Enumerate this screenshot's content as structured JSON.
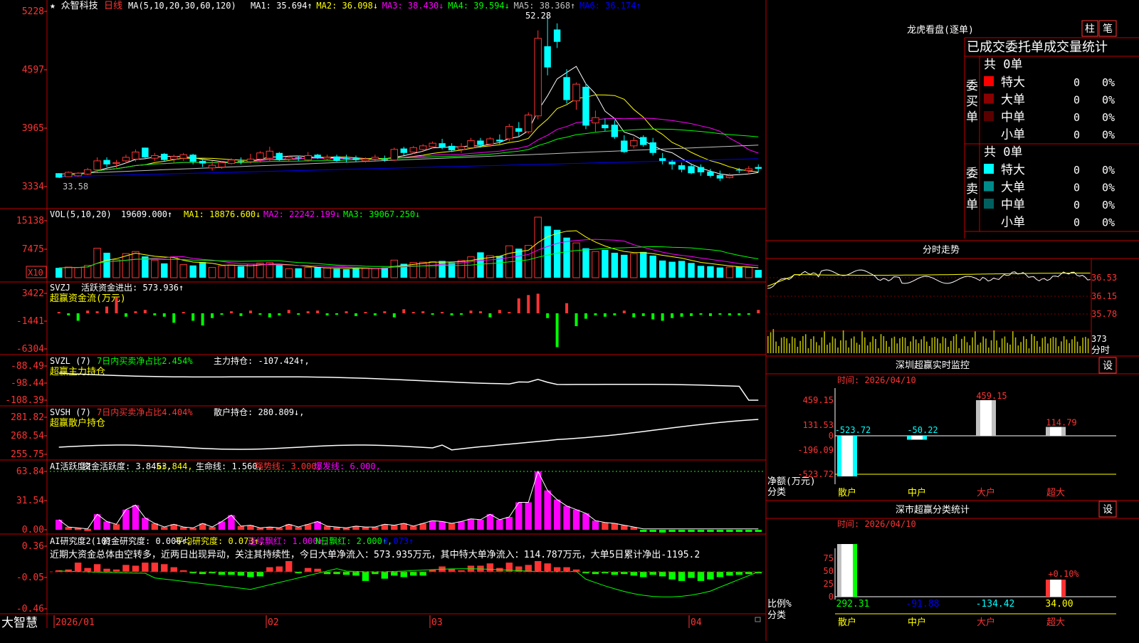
{
  "chart_data": [
    {
      "type": "candlestick",
      "stock_name": "众智科技",
      "period": "日线",
      "ma_params": "MA(5,10,20,30,60,120)",
      "ma_values": [
        {
          "name": "MA1",
          "value": "35.694",
          "arrow": "↑",
          "color": "#ffffff"
        },
        {
          "name": "MA2",
          "value": "36.098",
          "arrow": "↓",
          "color": "#ffff00"
        },
        {
          "name": "MA3",
          "value": "38.430",
          "arrow": "↓",
          "color": "#ff00ff"
        },
        {
          "name": "MA4",
          "value": "39.594",
          "arrow": "↓",
          "color": "#00ff00"
        },
        {
          "name": "MA5",
          "value": "38.368",
          "arrow": "↑",
          "color": "#c0c0c0"
        },
        {
          "name": "MA6",
          "value": "36.174",
          "arrow": "↑",
          "color": "#0000ff"
        }
      ],
      "y_ticks": [
        "5228",
        "4597",
        "3965",
        "3334"
      ],
      "y_range": [
        32.5,
        53.5
      ],
      "annot_high": "52.28",
      "annot_low": "33.58",
      "ohlc": [
        [
          34.5,
          34.5,
          34.1,
          34.0
        ],
        [
          34.1,
          34.7,
          34.1,
          34.6
        ],
        [
          34.2,
          34.6,
          34.1,
          34.5
        ],
        [
          34.4,
          35.1,
          34.3,
          34.9
        ],
        [
          34.9,
          36.3,
          34.6,
          35.9
        ],
        [
          36.0,
          36.3,
          35.2,
          35.5
        ],
        [
          35.6,
          36.0,
          35.1,
          35.7
        ],
        [
          35.9,
          36.6,
          35.6,
          36.3
        ],
        [
          36.1,
          37.2,
          35.8,
          36.9
        ],
        [
          37.4,
          37.4,
          36.2,
          36.3
        ],
        [
          36.2,
          36.8,
          35.9,
          36.5
        ],
        [
          36.7,
          36.8,
          35.9,
          36.0
        ],
        [
          36.1,
          36.6,
          35.7,
          36.4
        ],
        [
          36.2,
          36.8,
          35.9,
          36.6
        ],
        [
          36.6,
          36.7,
          35.5,
          35.8
        ],
        [
          35.9,
          36.1,
          35.2,
          35.6
        ],
        [
          35.1,
          35.9,
          34.8,
          35.4
        ],
        [
          35.2,
          35.9,
          35.0,
          35.7
        ],
        [
          35.6,
          36.2,
          35.5,
          36.0
        ],
        [
          35.9,
          36.3,
          35.5,
          35.8
        ],
        [
          35.8,
          36.7,
          35.6,
          36.1
        ],
        [
          36.1,
          37.0,
          35.7,
          36.8
        ],
        [
          36.2,
          37.5,
          35.9,
          37.0
        ],
        [
          36.8,
          36.9,
          35.9,
          36.0
        ],
        [
          36.1,
          36.5,
          35.9,
          36.3
        ],
        [
          36.3,
          36.5,
          35.9,
          36.2
        ],
        [
          36.0,
          36.9,
          35.8,
          36.5
        ],
        [
          36.6,
          36.7,
          36.1,
          36.2
        ],
        [
          36.1,
          36.6,
          35.9,
          36.3
        ],
        [
          36.4,
          36.6,
          35.8,
          35.9
        ],
        [
          36.2,
          36.6,
          35.7,
          36.1
        ],
        [
          36.2,
          36.5,
          35.8,
          36.0
        ],
        [
          35.9,
          36.3,
          35.7,
          36.1
        ],
        [
          36.1,
          36.6,
          35.9,
          36.3
        ],
        [
          36.1,
          36.5,
          35.8,
          36.0
        ],
        [
          36.0,
          37.4,
          35.9,
          37.2
        ],
        [
          37.3,
          37.5,
          36.5,
          36.8
        ],
        [
          36.9,
          37.6,
          36.7,
          37.4
        ],
        [
          37.2,
          37.8,
          37.0,
          37.6
        ],
        [
          37.5,
          38.1,
          37.3,
          37.9
        ],
        [
          37.9,
          38.4,
          37.2,
          37.4
        ],
        [
          37.6,
          37.9,
          36.9,
          37.1
        ],
        [
          37.2,
          37.9,
          36.8,
          37.5
        ],
        [
          37.4,
          38.5,
          37.3,
          38.2
        ],
        [
          38.2,
          38.5,
          37.4,
          37.7
        ],
        [
          37.8,
          38.6,
          37.5,
          38.4
        ],
        [
          38.3,
          38.9,
          37.8,
          38.1
        ],
        [
          38.4,
          40.1,
          38.1,
          39.8
        ],
        [
          39.6,
          40.3,
          38.7,
          39.2
        ],
        [
          39.2,
          41.4,
          39.0,
          41.1
        ],
        [
          41.0,
          50.7,
          40.6,
          49.8
        ],
        [
          48.9,
          52.3,
          45.6,
          46.5
        ],
        [
          50.8,
          51.5,
          48.7,
          49.4
        ],
        [
          45.4,
          46.3,
          42.4,
          42.8
        ],
        [
          42.7,
          44.8,
          41.7,
          44.6
        ],
        [
          44.3,
          44.7,
          39.5,
          39.9
        ],
        [
          40.2,
          41.6,
          39.1,
          40.8
        ],
        [
          40.0,
          40.7,
          39.3,
          39.6
        ],
        [
          40.0,
          40.5,
          38.4,
          38.6
        ],
        [
          38.2,
          38.8,
          36.8,
          36.9
        ],
        [
          37.6,
          38.6,
          37.3,
          38.2
        ],
        [
          38.6,
          38.8,
          37.5,
          37.7
        ],
        [
          38.0,
          38.5,
          36.5,
          36.8
        ],
        [
          36.2,
          36.8,
          35.5,
          35.9
        ],
        [
          35.8,
          36.0,
          34.9,
          35.5
        ],
        [
          35.4,
          35.7,
          34.6,
          34.9
        ],
        [
          35.3,
          35.6,
          34.4,
          34.5
        ],
        [
          35.2,
          35.5,
          34.2,
          34.6
        ],
        [
          34.7,
          35.0,
          34.0,
          34.2
        ],
        [
          34.3,
          34.8,
          33.6,
          33.9
        ],
        [
          34.0,
          34.5,
          33.9,
          34.2
        ],
        [
          34.9,
          35.1,
          34.5,
          34.8
        ],
        [
          34.8,
          35.3,
          34.4,
          35.0
        ],
        [
          35.2,
          35.5,
          34.6,
          35.0
        ]
      ],
      "volume": {
        "params": "VOL(5,10,20)",
        "value": "19609.000",
        "ma_values": [
          {
            "name": "MA1",
            "value": "18876.600",
            "arrow": "↓",
            "color": "#ffff00"
          },
          {
            "name": "MA2",
            "value": "22242.199",
            "arrow": "↓",
            "color": "#ff00ff"
          },
          {
            "name": "MA3",
            "value": "39067.250",
            "arrow": "↓",
            "color": "#00ff00"
          }
        ],
        "y_ticks": [
          "15138",
          "7475",
          "X10"
        ],
        "unit_tag": "X10",
        "values": [
          2400,
          2600,
          2500,
          3000,
          7200,
          6100,
          4400,
          5900,
          6400,
          5200,
          4300,
          3500,
          5100,
          3200,
          3000,
          3800,
          2500,
          2900,
          3100,
          2800,
          3300,
          3600,
          3700,
          3100,
          2200,
          2300,
          2500,
          2600,
          2400,
          2200,
          2100,
          2300,
          2400,
          2300,
          2500,
          4300,
          3400,
          3700,
          3800,
          3900,
          4100,
          3700,
          4200,
          5100,
          6200,
          5400,
          5300,
          7800,
          7100,
          7900,
          14800,
          12600,
          11700,
          9800,
          8500,
          7200,
          6400,
          6800,
          6100,
          5600,
          5900,
          6300,
          5400,
          4200,
          3900,
          4100,
          3600,
          2900,
          2800,
          2500,
          2600,
          2700,
          2500,
          1900
        ]
      }
    }
  ],
  "indicators": {
    "svzj": {
      "name": "SVZJ",
      "title": "活跃资金进出",
      "value": "573.936",
      "arrow": "↑",
      "subtitle": "超赢资金流(万元)",
      "y_ticks": [
        "3422",
        "-1441",
        "-6304"
      ]
    },
    "svzl": {
      "name": "SVZL (7)",
      "pct_label": "7日内买卖净占比",
      "pct_value": "2.454%",
      "title": "主力持仓",
      "value": "-107.424",
      "arrow": "↑",
      "subtitle": "超赢主力持仓",
      "y_ticks": [
        "-88.49",
        "-98.44",
        "-108.39"
      ]
    },
    "svsh": {
      "name": "SVSH (7)",
      "pct_label": "7日内买卖净占比",
      "pct_value": "4.404%",
      "title": "散户持仓",
      "value": "280.809",
      "arrow": "↓",
      "subtitle": "超赢散户持仓",
      "y_ticks": [
        "281.82",
        "268.54",
        "255.75"
      ]
    },
    "ai_active": {
      "name": "AI活跃度2",
      "title": "资金活跃度",
      "value": "3.845",
      "arrow": "↑",
      "val2": "63.844",
      "life_label": "生命线",
      "life_value": "1.560",
      "strong_label": "强势线",
      "strong_value": "3.000",
      "burst_label": "爆发线",
      "burst_value": "6.000",
      "y_ticks": [
        "63.84",
        "31.54",
        "0.00"
      ]
    },
    "ai_research": {
      "name": "AI研究度2(10)",
      "title": "资金研究度",
      "value": "0.006",
      "arrow": "↑",
      "avg_label": "平均研究度",
      "avg_value": "0.073",
      "avg_arrow": "↑",
      "red_label": "连续飘红",
      "red_value": "1.000",
      "red_arrow": "↑",
      "n_label": "N日飘红",
      "n_value": "2.000",
      "n_arrow": "↑",
      "last_value": "0.073",
      "last_arrow": "↑",
      "y_ticks": [
        "0.36",
        "-0.05",
        "-0.46"
      ],
      "comment": "近期大资金总体由空转多，近两日出现异动，关注其持续性，今日大单净流入：573.935万元，其中特大单净流入：114.787万元，大单5日累计净出-1195.2"
    }
  },
  "date_axis": {
    "brand": "大智慧",
    "labels": [
      "2026/01",
      "02",
      "03",
      "04"
    ]
  },
  "dragon_panel": {
    "title": "龙虎看盘(逐单)",
    "btn_bar": "柱",
    "btn_stroke": "笔",
    "subtitle": "已成交委托单成交量统计",
    "buy_label": "委买单",
    "sell_label": "委卖单",
    "buy_total": "共 0单",
    "sell_total": "共 0单",
    "buy_rows": [
      {
        "label": "特大",
        "count": "0",
        "pct": "0%",
        "color": "#ff0000"
      },
      {
        "label": "大单",
        "count": "0",
        "pct": "0%",
        "color": "#8b0000"
      },
      {
        "label": "中单",
        "count": "0",
        "pct": "0%",
        "color": "#5a0000"
      },
      {
        "label": "小单",
        "count": "0",
        "pct": "0%",
        "color": null
      }
    ],
    "sell_rows": [
      {
        "label": "特大",
        "count": "0",
        "pct": "0%",
        "color": "#00ffff"
      },
      {
        "label": "大单",
        "count": "0",
        "pct": "0%",
        "color": "#008b8b"
      },
      {
        "label": "中单",
        "count": "0",
        "pct": "0%",
        "color": "#006060"
      },
      {
        "label": "小单",
        "count": "0",
        "pct": "0%",
        "color": null
      }
    ]
  },
  "intraday": {
    "title": "分时走势",
    "y_ticks": [
      "36.53",
      "36.15",
      "35.78"
    ],
    "vol_tick": "373",
    "vol_label": "分时"
  },
  "sz_monitor": {
    "title": "深圳超赢实时监控",
    "btn": "设",
    "time_label": "时间",
    "date": "2026/04/10",
    "y_ticks": [
      "459.15",
      "131.53",
      "0",
      "-196.09",
      "-523.72"
    ],
    "y_label1": "净额(万元)",
    "y_label2": "分类",
    "categories": [
      "散户",
      "中户",
      "大户",
      "超大"
    ],
    "values": [
      -523.72,
      -50.22,
      459.15,
      114.79
    ],
    "value_labels": [
      "-523.72",
      "-50.22",
      "459.15",
      "114.79"
    ]
  },
  "sz_classify": {
    "title": "深市超赢分类统计",
    "btn": "设",
    "time_label": "时间",
    "date": "2026/04/10",
    "y_ticks": [
      "75",
      "50",
      "25",
      "0"
    ],
    "y_label1": "比例%",
    "y_label2": "分类",
    "categories": [
      "散户",
      "中户",
      "大户",
      "超大"
    ],
    "values": [
      292.31,
      -91.88,
      -134.42,
      34.0
    ],
    "value_labels": [
      "292.31",
      "-91.88",
      "-134.42",
      "34.00"
    ],
    "bar_label": "+0.10%"
  }
}
